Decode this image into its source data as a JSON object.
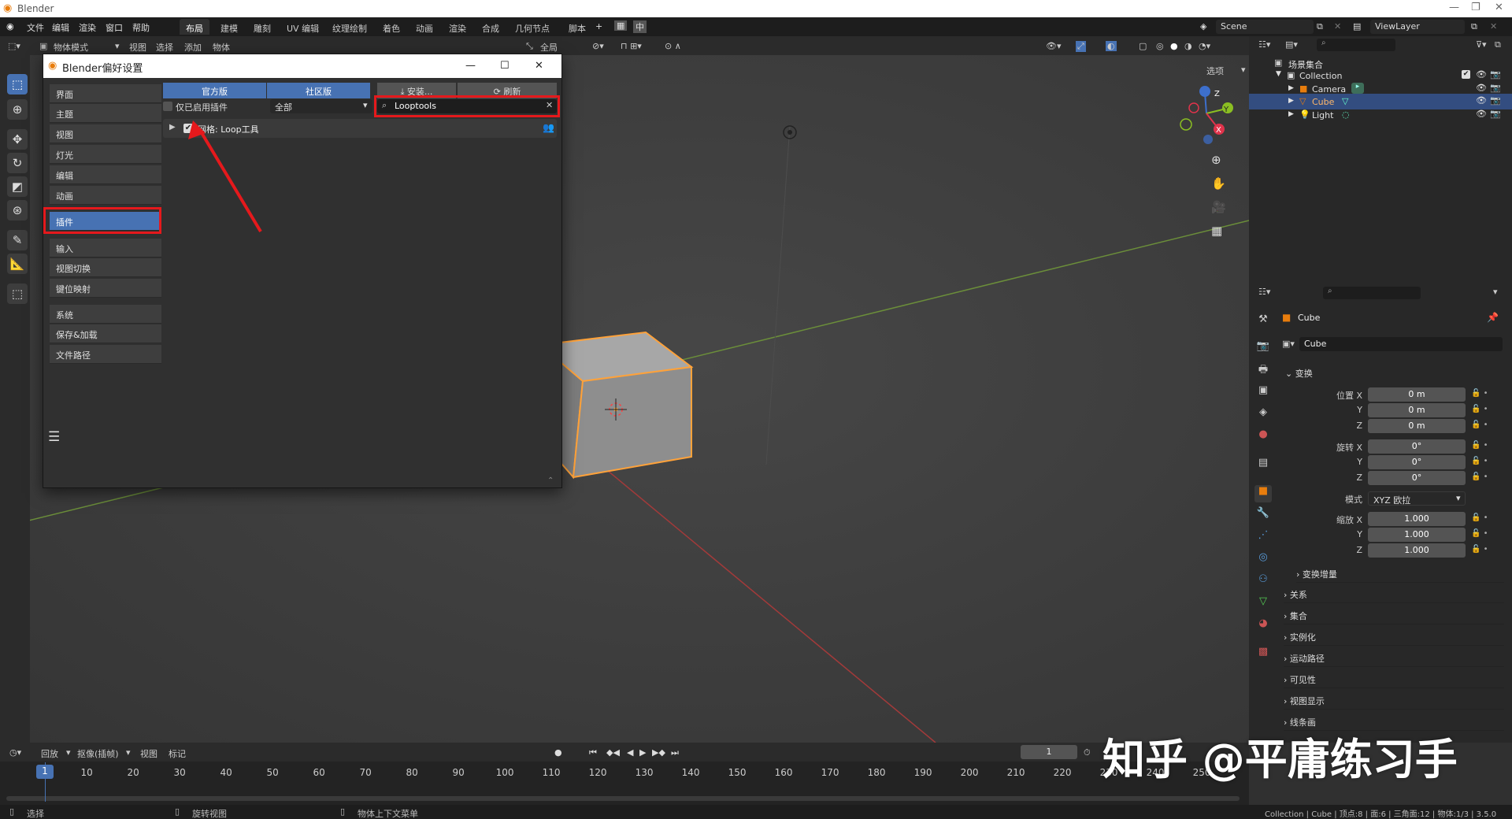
{
  "app": {
    "title": "Blender"
  },
  "menu": [
    "文件",
    "编辑",
    "渲染",
    "窗口",
    "帮助"
  ],
  "workspaces": [
    "布局",
    "建模",
    "雕刻",
    "UV 编辑",
    "纹理绘制",
    "着色",
    "动画",
    "渲染",
    "合成",
    "几何节点",
    "脚本"
  ],
  "workspace_plus": "+",
  "ime_label": "中",
  "scene": {
    "label": "Scene",
    "view_layer": "ViewLayer"
  },
  "viewport_header": {
    "mode": "物体模式",
    "menus": [
      "视图",
      "选择",
      "添加",
      "物体"
    ],
    "orientation": "全局",
    "options": "选项"
  },
  "prefs": {
    "title": "Blender偏好设置",
    "sidebar": {
      "group1": [
        "界面",
        "主题",
        "视图",
        "灯光",
        "编辑",
        "动画"
      ],
      "addons": "插件",
      "group2": [
        "输入",
        "视图切换",
        "键位映射"
      ],
      "group3": [
        "系统",
        "保存&加载",
        "文件路径"
      ]
    },
    "tabs": {
      "official": "官方版",
      "community": "社区版",
      "install": "安装...",
      "refresh": "刷新"
    },
    "enabled_only": "仅已启用插件",
    "category": "全部",
    "search_value": "Looptools",
    "addon_row": "网格: Loop工具",
    "menu_icon": "hamburger-icon"
  },
  "outliner": {
    "header": "场景集合",
    "items": [
      {
        "name": "Collection"
      },
      {
        "name": "Camera"
      },
      {
        "name": "Cube"
      },
      {
        "name": "Light"
      }
    ]
  },
  "properties": {
    "object_name": "Cube",
    "data_name": "Cube",
    "transform": "变换",
    "location_label": "位置 X",
    "rotation_label": "旋转 X",
    "scale_label": "缩放 X",
    "axis_y": "Y",
    "axis_z": "Z",
    "location": [
      "0 m",
      "0 m",
      "0 m"
    ],
    "rotation": [
      "0°",
      "0°",
      "0°"
    ],
    "mode_label": "模式",
    "mode_value": "XYZ 欧拉",
    "scale": [
      "1.000",
      "1.000",
      "1.000"
    ],
    "delta": "变换增量",
    "sections": [
      "关系",
      "集合",
      "实例化",
      "运动路径",
      "可见性",
      "视图显示",
      "线条画"
    ]
  },
  "timeline": {
    "menus": [
      "回放",
      "抠像(插帧)",
      "视图",
      "标记"
    ],
    "current_frame": "1",
    "frames": [
      "1",
      "10",
      "20",
      "30",
      "40",
      "50",
      "60",
      "70",
      "80",
      "90",
      "100",
      "110",
      "120",
      "130",
      "140",
      "150",
      "160",
      "170",
      "180",
      "190",
      "200",
      "210",
      "220",
      "230",
      "240",
      "250"
    ]
  },
  "status": {
    "left": "选择",
    "middle": "旋转视图",
    "right": "物体上下文菜单",
    "stats": "Collection | Cube | 顶点:8 | 面:6 | 三角面:12 | 物体:1/3 | 3.5.0"
  },
  "watermark": "知乎 @平庸练习手",
  "colors": {
    "accent": "#4772b3",
    "highlight": "#e5191c",
    "selection": "#ffa23a"
  }
}
